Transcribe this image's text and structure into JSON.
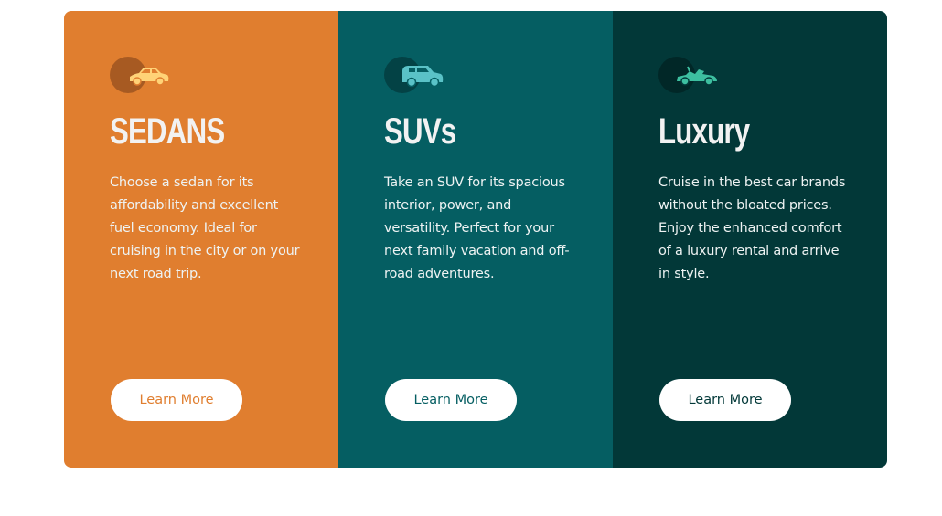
{
  "cards": [
    {
      "icon": "sedan-car-icon",
      "title": "SEDANS",
      "description": "Choose a sedan for its affordability and excellent fuel economy. Ideal for cruising in the city or on your next road trip.",
      "button_label": "Learn More",
      "background_color": "#e07e2f",
      "icon_color": "#ffd277"
    },
    {
      "icon": "suv-car-icon",
      "title": "SUVs",
      "description": "Take an SUV for its spacious interior, power, and versatility. Perfect for your next family vacation and off-road adventures.",
      "button_label": "Learn More",
      "background_color": "#055e62",
      "icon_color": "#5ac2c7"
    },
    {
      "icon": "luxury-car-icon",
      "title": "Luxury",
      "description": "Cruise in the best car brands without the bloated prices. Enjoy the enhanced comfort of a luxury rental and arrive in style.",
      "button_label": "Learn More",
      "background_color": "#023838",
      "icon_color": "#3dbfa0"
    }
  ]
}
